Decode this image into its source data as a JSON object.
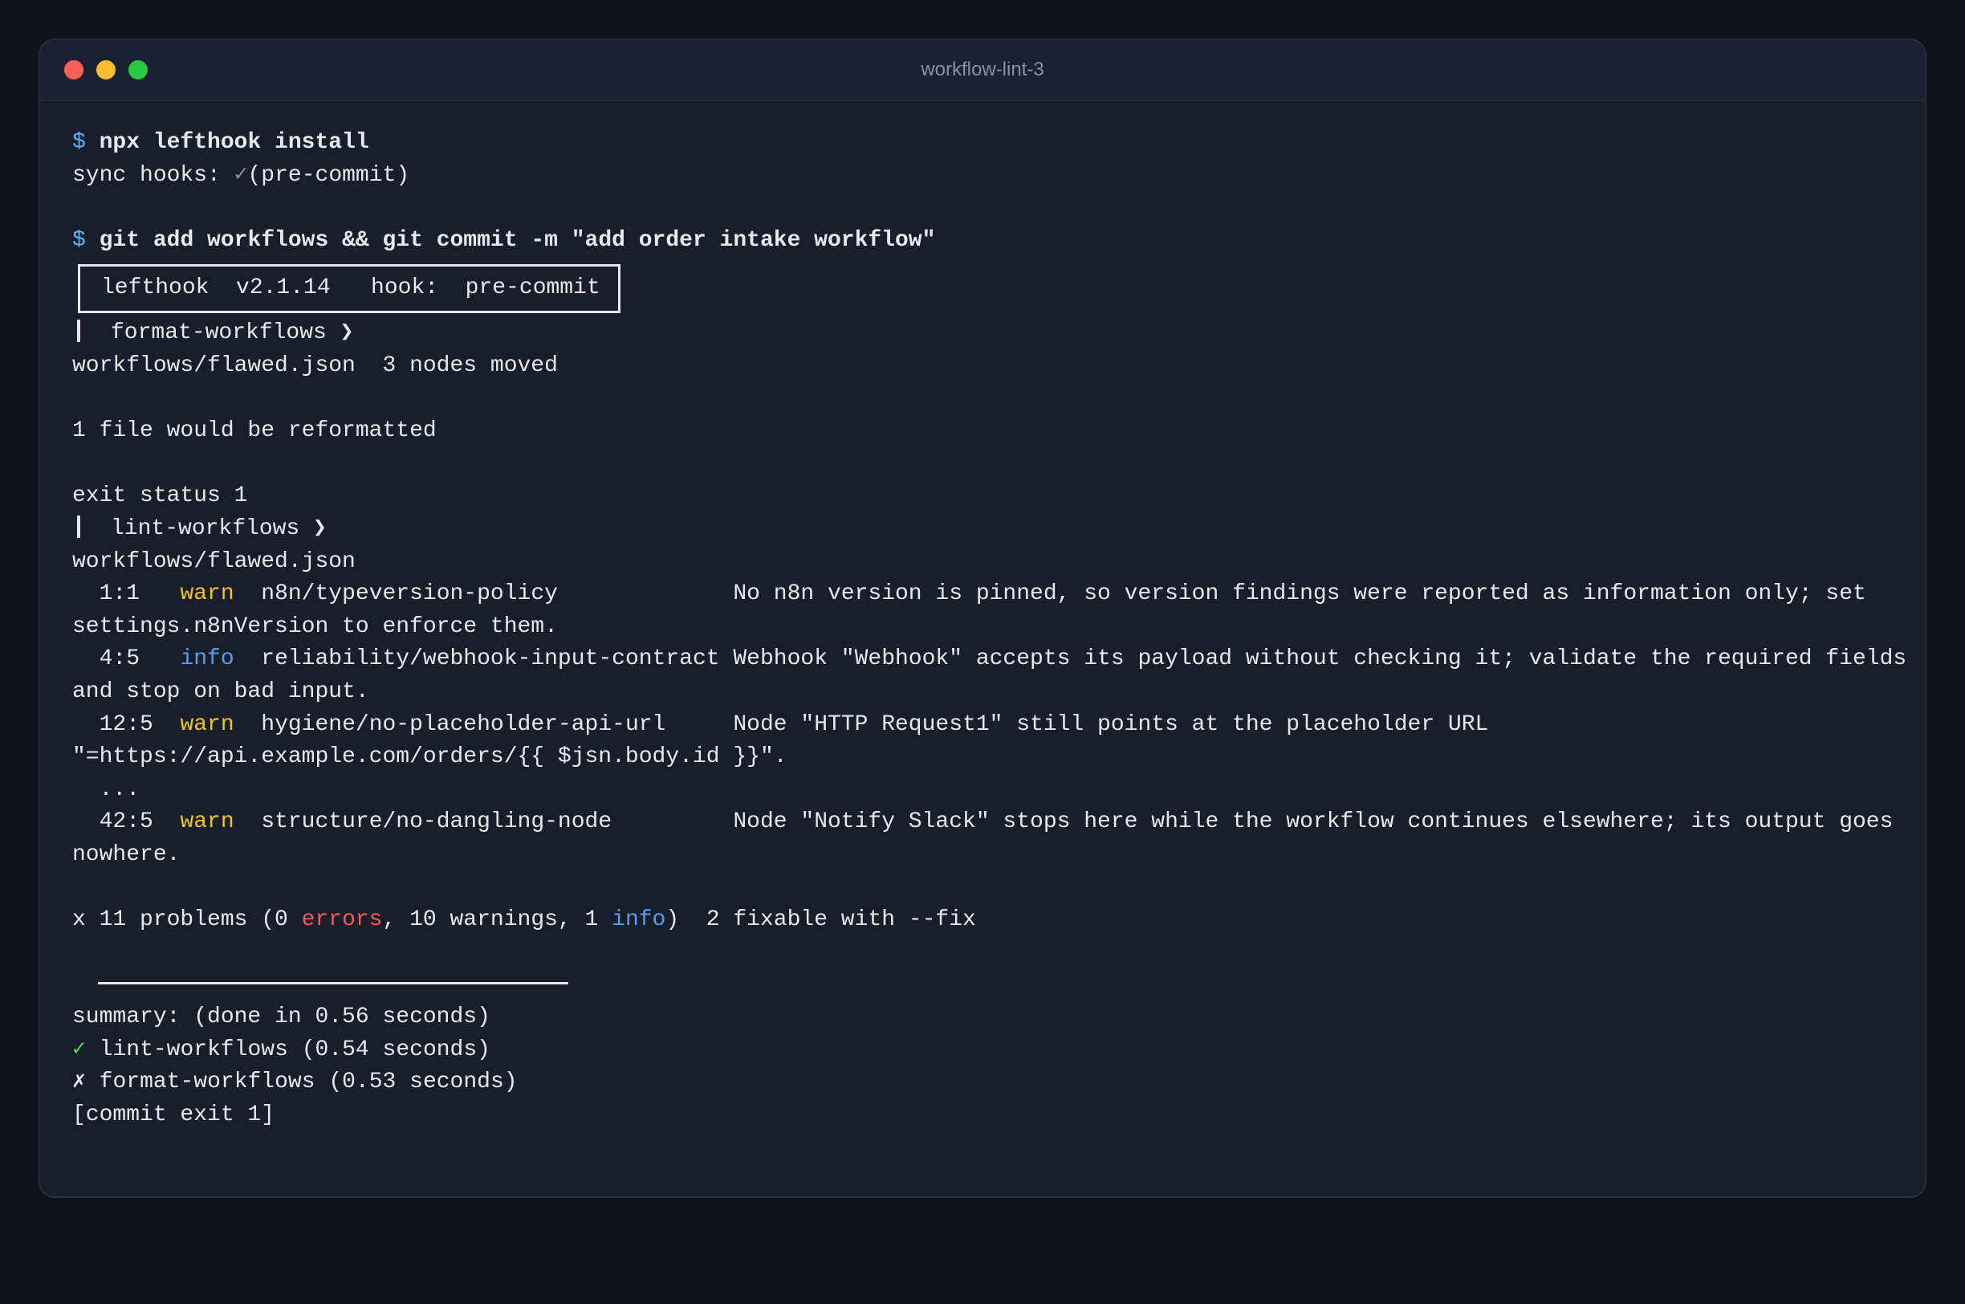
{
  "colors": {
    "prompt": "#5fb3ff",
    "warn": "#f0c419",
    "info": "#5a9cf0",
    "error": "#ef5b5b",
    "ok": "#4ad46b",
    "title": "#8c909e",
    "close": "#fe5f57",
    "minimize": "#febc2e",
    "zoom": "#28c840"
  },
  "window": {
    "title": "workflow-lint-3"
  },
  "terminal": {
    "cmd1": {
      "prompt": "$",
      "text": "npx lefthook install"
    },
    "sync": {
      "label": "sync hooks: ",
      "check": "✓",
      "text": "(pre-commit)"
    },
    "cmd2": {
      "prompt": "$",
      "text": "git add workflows && git commit -m \"add order intake workflow\""
    },
    "banner": "lefthook  v2.1.14   hook:  pre-commit",
    "format": {
      "header": "format-workflows ❯",
      "file_line": "workflows/flawed.json  3 nodes moved",
      "summary": "1 file would be reformatted",
      "exit": "exit status 1"
    },
    "lint": {
      "header": "lint-workflows ❯",
      "file": "workflows/flawed.json",
      "findings": [
        {
          "pos": "1:1",
          "level": "warn",
          "rule": "n8n/typeversion-policy",
          "msg": "No n8n version is pinned, so version findings were reported as information only; set",
          "cont": "settings.n8nVersion to enforce them."
        },
        {
          "pos": "4:5",
          "level": "info",
          "rule": "reliability/webhook-input-contract",
          "msg": "Webhook \"Webhook\" accepts its payload without checking it; validate the required fields",
          "cont": "and stop on bad input."
        },
        {
          "pos": "12:5",
          "level": "warn",
          "rule": "hygiene/no-placeholder-api-url",
          "msg": "Node \"HTTP Request1\" still points at the placeholder URL",
          "cont": "\"=https://api.example.com/orders/{{ $jsn.body.id }}\"."
        },
        {
          "pos": "42:5",
          "level": "warn",
          "rule": "structure/no-dangling-node",
          "msg": "Node \"Notify Slack\" stops here while the workflow continues elsewhere; its output goes",
          "cont": "nowhere."
        }
      ],
      "ellipsis": "...",
      "problems": {
        "prefix": "x 11 problems (0 ",
        "errors_word": "errors",
        "mid": ", 10 warnings, 1 ",
        "info_word": "info",
        "suffix": ")  2 fixable with --fix"
      }
    },
    "summary": {
      "title": "summary: (done in 0.56 seconds)",
      "ok_mark": "✓",
      "ok_text": "lint-workflows (0.54 seconds)",
      "fail_mark": "✗",
      "fail_text": "format-workflows (0.53 seconds)",
      "commit_exit": "[commit exit 1]"
    }
  }
}
